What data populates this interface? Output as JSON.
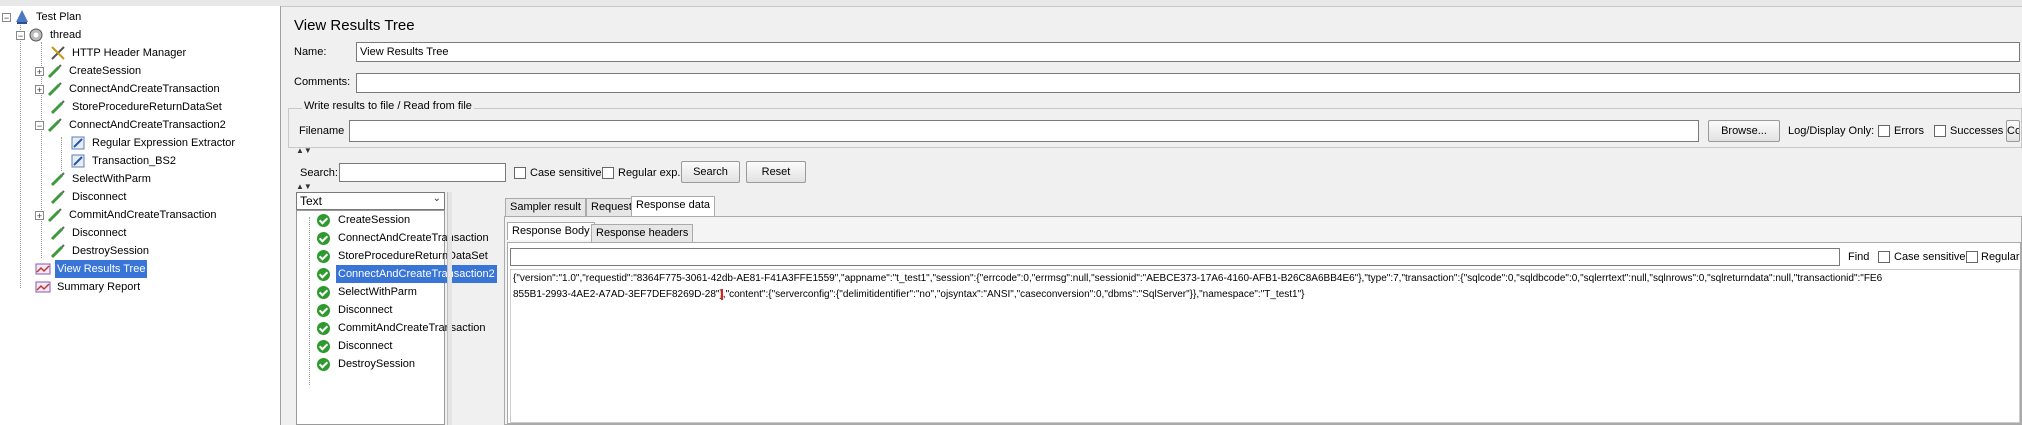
{
  "tree": {
    "nodes": [
      {
        "label": "Test Plan",
        "icon": "test-plan-icon"
      },
      {
        "label": "thread",
        "icon": "thread-group-icon"
      },
      {
        "label": "HTTP Header Manager",
        "icon": "config-tool-icon"
      },
      {
        "label": "CreateSession",
        "icon": "sampler-icon"
      },
      {
        "label": "ConnectAndCreateTransaction",
        "icon": "sampler-icon"
      },
      {
        "label": "StoreProcedureReturnDataSet",
        "icon": "sampler-icon"
      },
      {
        "label": "ConnectAndCreateTransaction2",
        "icon": "sampler-icon"
      },
      {
        "label": "Regular Expression Extractor",
        "icon": "post-processor-icon"
      },
      {
        "label": "Transaction_BS2",
        "icon": "post-processor-icon"
      },
      {
        "label": "SelectWithParm",
        "icon": "sampler-icon"
      },
      {
        "label": "Disconnect",
        "icon": "sampler-icon"
      },
      {
        "label": "CommitAndCreateTransaction",
        "icon": "sampler-icon"
      },
      {
        "label": "Disconnect",
        "icon": "sampler-icon"
      },
      {
        "label": "DestroySession",
        "icon": "sampler-icon"
      },
      {
        "label": "View Results Tree",
        "icon": "listener-icon"
      },
      {
        "label": "Summary Report",
        "icon": "listener-icon"
      }
    ]
  },
  "panel": {
    "title": "View Results Tree",
    "name_label": "Name:",
    "name_value": "View Results Tree",
    "comments_label": "Comments:",
    "comments_value": "",
    "file_group_title": "Write results to file / Read from file",
    "filename_label": "Filename",
    "filename_value": "",
    "browse_label": "Browse...",
    "log_display_label": "Log/Display Only:",
    "errors_label": "Errors",
    "successes_label": "Successes",
    "configure_label": "Configure"
  },
  "search": {
    "label": "Search:",
    "value": "",
    "case_sensitive_label": "Case sensitive",
    "regex_label": "Regular exp.",
    "search_button": "Search",
    "reset_button": "Reset"
  },
  "renderer": {
    "selected": "Text"
  },
  "results": [
    {
      "label": "CreateSession"
    },
    {
      "label": "ConnectAndCreateTransaction"
    },
    {
      "label": "StoreProcedureReturnDataSet"
    },
    {
      "label": "ConnectAndCreateTransaction2"
    },
    {
      "label": "SelectWithParm"
    },
    {
      "label": "Disconnect"
    },
    {
      "label": "CommitAndCreateTransaction"
    },
    {
      "label": "Disconnect"
    },
    {
      "label": "DestroySession"
    }
  ],
  "tabs": {
    "sampler_result": "Sampler result",
    "request": "Request",
    "response_data": "Response data"
  },
  "subtabs": {
    "response_body": "Response Body",
    "response_headers": "Response headers"
  },
  "find": {
    "value": "",
    "find_label": "Find",
    "case_sensitive_label": "Case sensitive",
    "regex_label": "Regular exp."
  },
  "response": {
    "line1": "{\"version\":\"1.0\",\"requestid\":\"8364F775-3061-42db-AE81-F41A3FFE1559\",\"appname\":\"t_test1\",\"session\":{\"errcode\":0,\"errmsg\":null,\"sessionid\":\"AEBCE373-17A6-4160-AFB1-B26C8A6BB4E6\"},\"type\":7,\"transaction\":{\"sqlcode\":0,\"sqldbcode\":0,\"sqlerrtext\":null,\"sqlnrows\":0,\"sqlreturndata\":null,\"transactionid\":\"FE6",
    "line2_highlight": "855B1-2993-4AE2-A7AD-3EF7DEF8269D-28\"",
    "line2_rest": "},\"content\":{\"serverconfig\":{\"delimitidentifier\":\"no\",\"ojsyntax\":\"ANSI\",\"caseconversion\":0,\"dbms\":\"SqlServer\"}},\"namespace\":\"T_test1\"}"
  },
  "colors": {
    "selection": "#3875d7",
    "highlight_box": "#e0201c",
    "success": "#2e9a2e"
  }
}
